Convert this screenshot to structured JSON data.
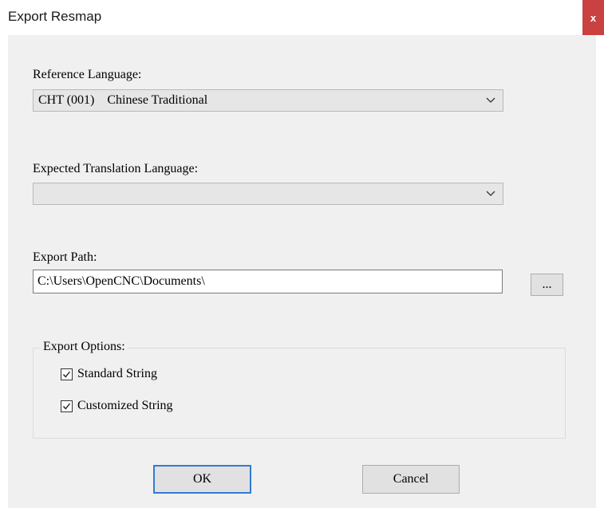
{
  "window": {
    "title": "Export Resmap",
    "close_label": "x"
  },
  "reference_language": {
    "label": "Reference Language:",
    "selected": "CHT (001)    Chinese Traditional"
  },
  "expected_translation_language": {
    "label": "Expected Translation Language:",
    "selected": ""
  },
  "export_path": {
    "label": "Export Path:",
    "value": "C:\\Users\\OpenCNC\\Documents\\",
    "browse_label": "..."
  },
  "export_options": {
    "title": "Export Options:",
    "options": [
      {
        "label": "Standard String",
        "checked": true
      },
      {
        "label": "Customized String",
        "checked": true
      }
    ]
  },
  "buttons": {
    "ok": "OK",
    "cancel": "Cancel"
  },
  "colors": {
    "close_bg": "#c94141",
    "default_button_border": "#2f7bd7",
    "dialog_bg": "#f0f0f0"
  },
  "icons": [
    "close-icon",
    "chevron-down-icon",
    "checkmark-icon"
  ]
}
